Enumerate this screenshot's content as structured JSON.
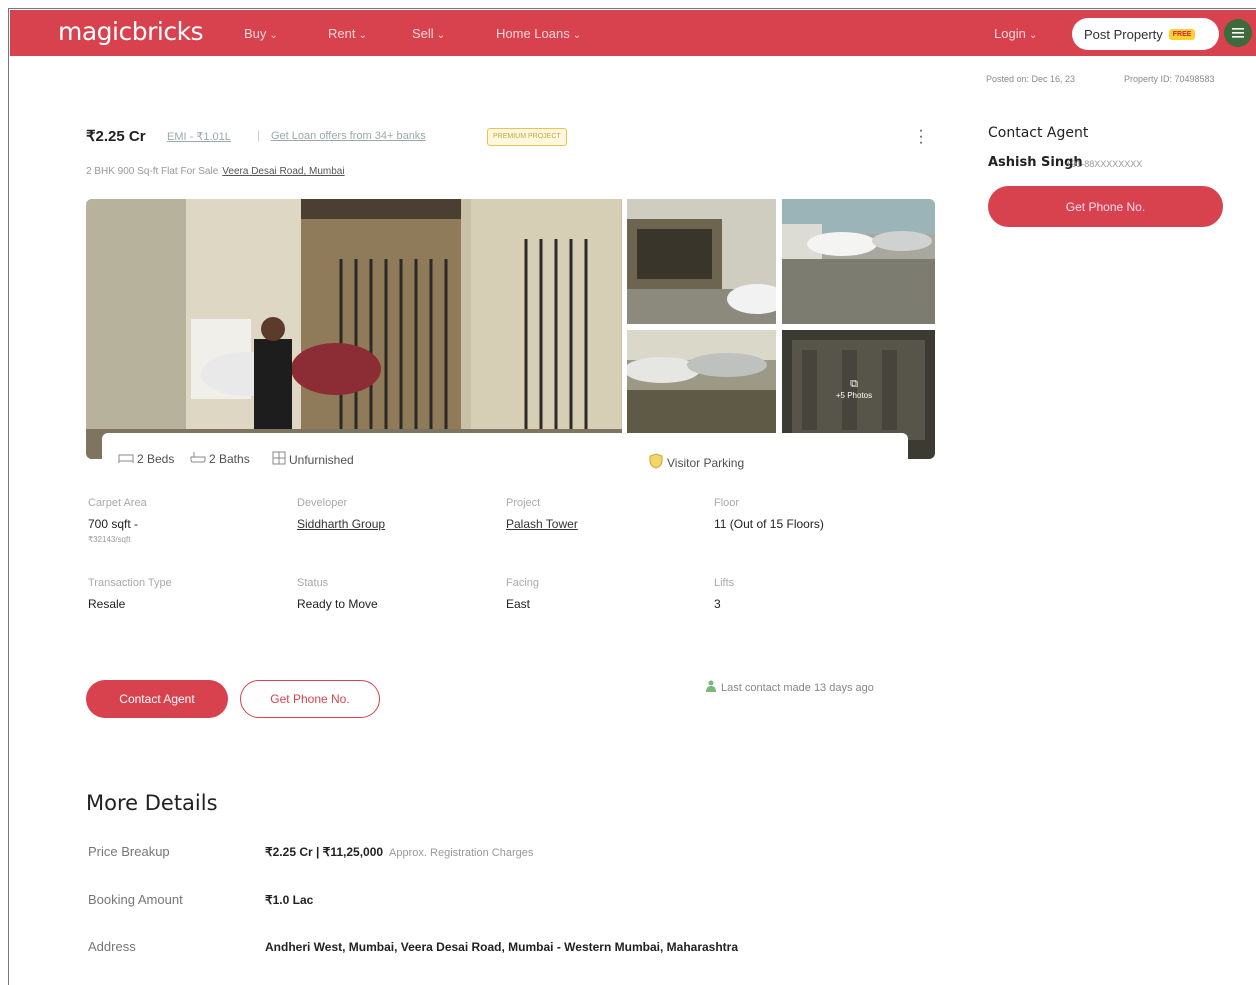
{
  "header": {
    "logo": "magicbricks",
    "nav": [
      {
        "label": "Buy"
      },
      {
        "label": "Rent"
      },
      {
        "label": "Sell"
      },
      {
        "label": "Home Loans"
      }
    ],
    "login": "Login",
    "post_property": "Post Property",
    "free_badge": "FREE"
  },
  "meta": {
    "posted_on": "Posted on: Dec 16, 23",
    "property_id": "Property ID: 70498583"
  },
  "summary": {
    "price": "₹2.25 Cr",
    "emi": "EMI - ₹1.01L",
    "separator": "|",
    "loan_offer": "Get Loan offers from 34+ banks",
    "premium_badge": "PREMIUM PROJECT",
    "title": "2 BHK 900 Sq-ft Flat For Sale",
    "location": "Veera Desai Road, Mumbai"
  },
  "gallery": {
    "photo_count": "+5 Photos"
  },
  "amenities": {
    "beds": "2 Beds",
    "baths": "2 Baths",
    "furnishing": "Unfurnished",
    "parking": "Visitor Parking"
  },
  "facts": [
    {
      "label": "Carpet Area",
      "value": "700 sqft -",
      "sub": "₹32143/sqft"
    },
    {
      "label": "Developer",
      "value": "Siddharth Group"
    },
    {
      "label": "Project",
      "value": "Palash Tower"
    },
    {
      "label": "Floor",
      "value": "11 (Out of 15 Floors)"
    },
    {
      "label": "Transaction Type",
      "value": "Resale"
    },
    {
      "label": "Status",
      "value": "Ready to Move"
    },
    {
      "label": "Facing",
      "value": "East"
    },
    {
      "label": "Lifts",
      "value": "3"
    }
  ],
  "actions": {
    "contact_agent": "Contact Agent",
    "get_phone": "Get Phone No.",
    "last_contact": "Last contact made 13 days ago"
  },
  "agent": {
    "title": "Contact Agent",
    "name": "Ashish Singh",
    "phone": "+91-88XXXXXXXX",
    "button": "Get Phone No."
  },
  "more_details": {
    "title": "More Details",
    "rows": [
      {
        "label": "Price Breakup",
        "value": "₹2.25 Cr | ₹11,25,000",
        "note": "Approx. Registration Charges"
      },
      {
        "label": "Booking Amount",
        "value": "₹1.0 Lac"
      },
      {
        "label": "Address",
        "value": "Andheri West, Mumbai, Veera Desai Road, Mumbai - Western Mumbai, Maharashtra"
      }
    ]
  },
  "colors": {
    "brand": "#d8424e",
    "badge": "#ffd12e"
  }
}
